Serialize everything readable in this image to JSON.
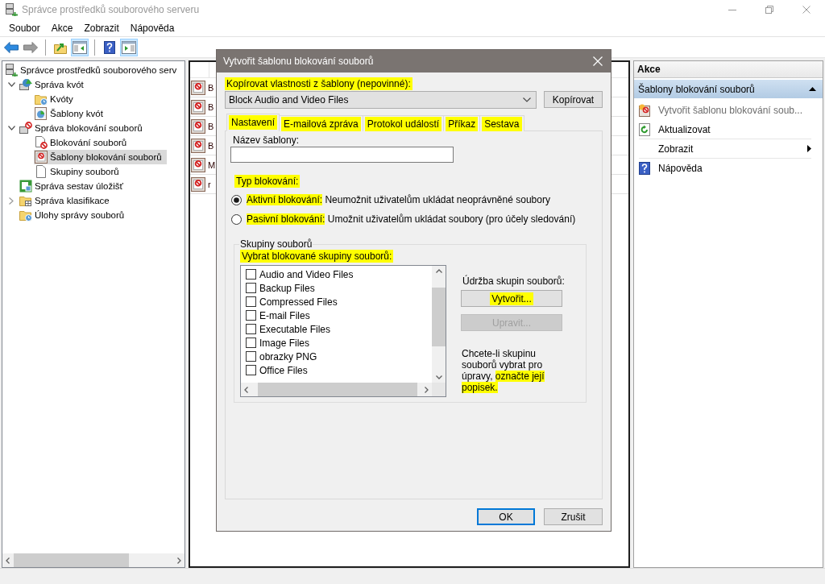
{
  "window": {
    "title": "Správce prostředků souborového serveru"
  },
  "menu": [
    "Soubor",
    "Akce",
    "Zobrazit",
    "Nápověda"
  ],
  "toolbar": {
    "groups": [
      {
        "buttons": [
          {
            "kind": "back",
            "disabled": false,
            "pressed": false
          },
          {
            "kind": "forward",
            "disabled": true,
            "pressed": false
          }
        ]
      },
      {
        "buttons": [
          {
            "kind": "up",
            "disabled": false,
            "pressed": false
          },
          {
            "kind": "console-tree",
            "disabled": false,
            "pressed": true
          }
        ]
      },
      {
        "buttons": [
          {
            "kind": "help",
            "disabled": false,
            "pressed": false
          },
          {
            "kind": "action-pane",
            "disabled": false,
            "pressed": true
          }
        ]
      }
    ]
  },
  "tree": {
    "nodes": [
      {
        "label": "Správce prostředků souborového serv",
        "kind": "server",
        "selected": false,
        "children": [
          {
            "label": "Správa kvót",
            "kind": "quota",
            "expanded": true,
            "selected": false,
            "children": [
              {
                "label": "Kvóty",
                "kind": "folder-clock",
                "selected": false
              },
              {
                "label": "Šablony kvót",
                "kind": "pie-template",
                "selected": false
              }
            ]
          },
          {
            "label": "Správa blokování souborů",
            "kind": "server-block",
            "expanded": true,
            "selected": false,
            "children": [
              {
                "label": "Blokování souborů",
                "kind": "doc-block",
                "selected": false
              },
              {
                "label": "Šablony blokování souborů",
                "kind": "template-block",
                "selected": true
              },
              {
                "label": "Skupiny souborů",
                "kind": "doc",
                "selected": false
              }
            ]
          },
          {
            "label": "Správa sestav úložišť",
            "kind": "report",
            "selected": false
          },
          {
            "label": "Správa klasifikace",
            "kind": "folder-table",
            "expanded": false,
            "selected": false
          },
          {
            "label": "Úlohy správy souborů",
            "kind": "folder-clock",
            "selected": false
          }
        ]
      }
    ]
  },
  "list": {
    "rows": [
      {
        "text": "B"
      },
      {
        "text": "B"
      },
      {
        "text": "B"
      },
      {
        "text": "B"
      },
      {
        "text": "M"
      },
      {
        "text": "r"
      }
    ]
  },
  "actions": {
    "title": "Akce",
    "section": {
      "title": "Šablony blokování souborů",
      "expanded": true
    },
    "items": [
      {
        "label": "Vytvořit šablonu blokování soub...",
        "kind": "create",
        "disabled": true,
        "separator_before": false
      },
      {
        "label": "Aktualizovat",
        "kind": "refresh",
        "disabled": false,
        "separator_before": false
      },
      {
        "label": "Zobrazit",
        "kind": "submenu",
        "disabled": false,
        "separator_before": true
      },
      {
        "label": "Nápověda",
        "kind": "help",
        "disabled": false,
        "separator_before": true
      }
    ]
  },
  "dialog": {
    "title": "Vytvořit šablonu blokování souborů",
    "copy_label": {
      "text": "Kopírovat vlastnosti z šablony (nepovinné):",
      "highlighted": true
    },
    "template_select": {
      "value": "Block Audio and Video Files"
    },
    "copy_button": {
      "label": "Kopírovat"
    },
    "tabs": [
      {
        "label": "Nastavení",
        "selected": true,
        "highlighted": true
      },
      {
        "label": "E-mailová zpráva",
        "selected": false,
        "highlighted": true
      },
      {
        "label": "Protokol událostí",
        "selected": false,
        "highlighted": true
      },
      {
        "label": "Příkaz",
        "selected": false,
        "highlighted": true
      },
      {
        "label": "Sestava",
        "selected": false,
        "highlighted": true
      }
    ],
    "name_field": {
      "label": "Název šablony:"
    },
    "blocking_type": {
      "label": {
        "text": "Typ blokování:",
        "highlighted": true
      },
      "options": [
        {
          "selected": true,
          "label": [
            {
              "text": "Aktivní blokování:",
              "highlighted": true
            },
            {
              "text": "Neumožnit uživatelům ukládat neoprávněné soubory",
              "highlighted": false
            }
          ]
        },
        {
          "selected": false,
          "label": [
            {
              "text": "Pasivní blokování:",
              "highlighted": true
            },
            {
              "text": "Umožnit uživatelům ukládat soubory (pro účely sledování)",
              "highlighted": false
            }
          ]
        }
      ]
    },
    "file_groups": {
      "title": "Skupiny souborů",
      "list_label": {
        "text": "Vybrat blokované skupiny souborů:",
        "highlighted": true
      },
      "items": [
        {
          "label": "Audio and Video Files",
          "checked": false
        },
        {
          "label": "Backup Files",
          "checked": false
        },
        {
          "label": "Compressed Files",
          "checked": false
        },
        {
          "label": "E-mail Files",
          "checked": false
        },
        {
          "label": "Executable Files",
          "checked": false
        },
        {
          "label": "Image Files",
          "checked": false
        },
        {
          "label": "obrazky PNG",
          "checked": false
        },
        {
          "label": "Office Files",
          "checked": false
        }
      ],
      "maintenance_label": "Údržba skupin souborů:",
      "buttons": [
        {
          "label": "Vytvořit...",
          "disabled": false,
          "highlighted": true
        },
        {
          "label": "Upravit...",
          "disabled": true,
          "highlighted": false
        }
      ],
      "hint": [
        {
          "text": "Chcete-li skupinu souborů vybrat pro úpravy,",
          "highlighted": false
        },
        {
          "text": "označte její popisek.",
          "highlighted": true
        }
      ]
    },
    "buttons": [
      {
        "label": "OK",
        "default": true
      },
      {
        "label": "Zrušit",
        "default": false
      }
    ]
  }
}
